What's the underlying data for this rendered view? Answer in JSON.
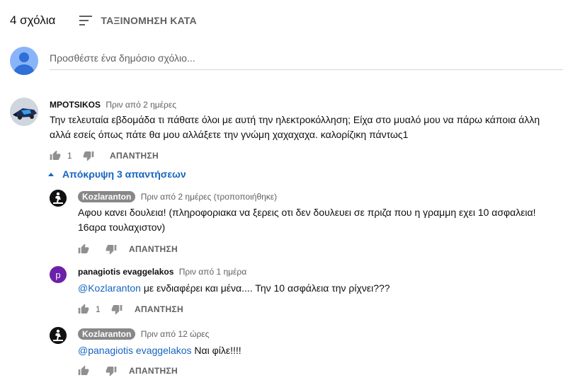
{
  "header": {
    "comment_count": "4 σχόλια",
    "sort_label": "ΤΑΞΙΝΟΜΗΣΗ ΚΑΤΑ"
  },
  "add_comment": {
    "placeholder": "Προσθέστε ένα δημόσιο σχόλιο..."
  },
  "comment": {
    "author": "ΜΡΟΤSIKOS",
    "time": "Πριν από 2 ημέρες",
    "text_line1": "Την τελευταία εβδομάδα τι πάθατε όλοι με αυτή την ηλεκτροκόλληση; Είχα στο μυαλό μου να πάρω κάποια άλλη",
    "text_line2": "αλλά  εσείς όπως πάτε θα μου αλλάξετε την γνώμη χαχαχαχα. καλορίζικη πάντως1",
    "likes": "1",
    "reply_label": "ΑΠΑΝΤΗΣΗ"
  },
  "hide_replies_label": "Απόκρυψη 3 απαντήσεων",
  "replies": [
    {
      "author": "Kozlaranton",
      "time": "Πριν από 2 ημέρες (τροποποιήθηκε)",
      "text_line1": "Αφου κανει δουλεια! (πληροφοριακα να ξερεις οτι δεν δουλευει σε πριζα που η γραμμη εχει 10 ασφαλεια!",
      "text_line2": "16αρα τουλαχιστον)",
      "likes": "",
      "reply_label": "ΑΠΑΝΤΗΣΗ"
    },
    {
      "author": "panagiotis evaggelakos",
      "avatar_letter": "p",
      "time": "Πριν από 1 ημέρα",
      "mention": "@Kozlaranton",
      "text": " με ενδιαφέρει και μένα.... Την 10 ασφάλεια την ρίχνει???",
      "likes": "1",
      "reply_label": "ΑΠΑΝΤΗΣΗ"
    },
    {
      "author": "Kozlaranton",
      "time": "Πριν από 12 ώρες",
      "mention": "@panagiotis evaggelakos",
      "text": " Ναι φίλε!!!!",
      "likes": "",
      "reply_label": "ΑΠΑΝΤΗΣΗ"
    }
  ],
  "icons": [
    "sort-icon",
    "thumb-up-icon",
    "thumb-down-icon",
    "caret-up-icon"
  ],
  "colors": {
    "link": "#1565c0",
    "secondary_text": "#606060",
    "badge": "#888888",
    "avatar_letter_bg": "#6b21a8"
  }
}
